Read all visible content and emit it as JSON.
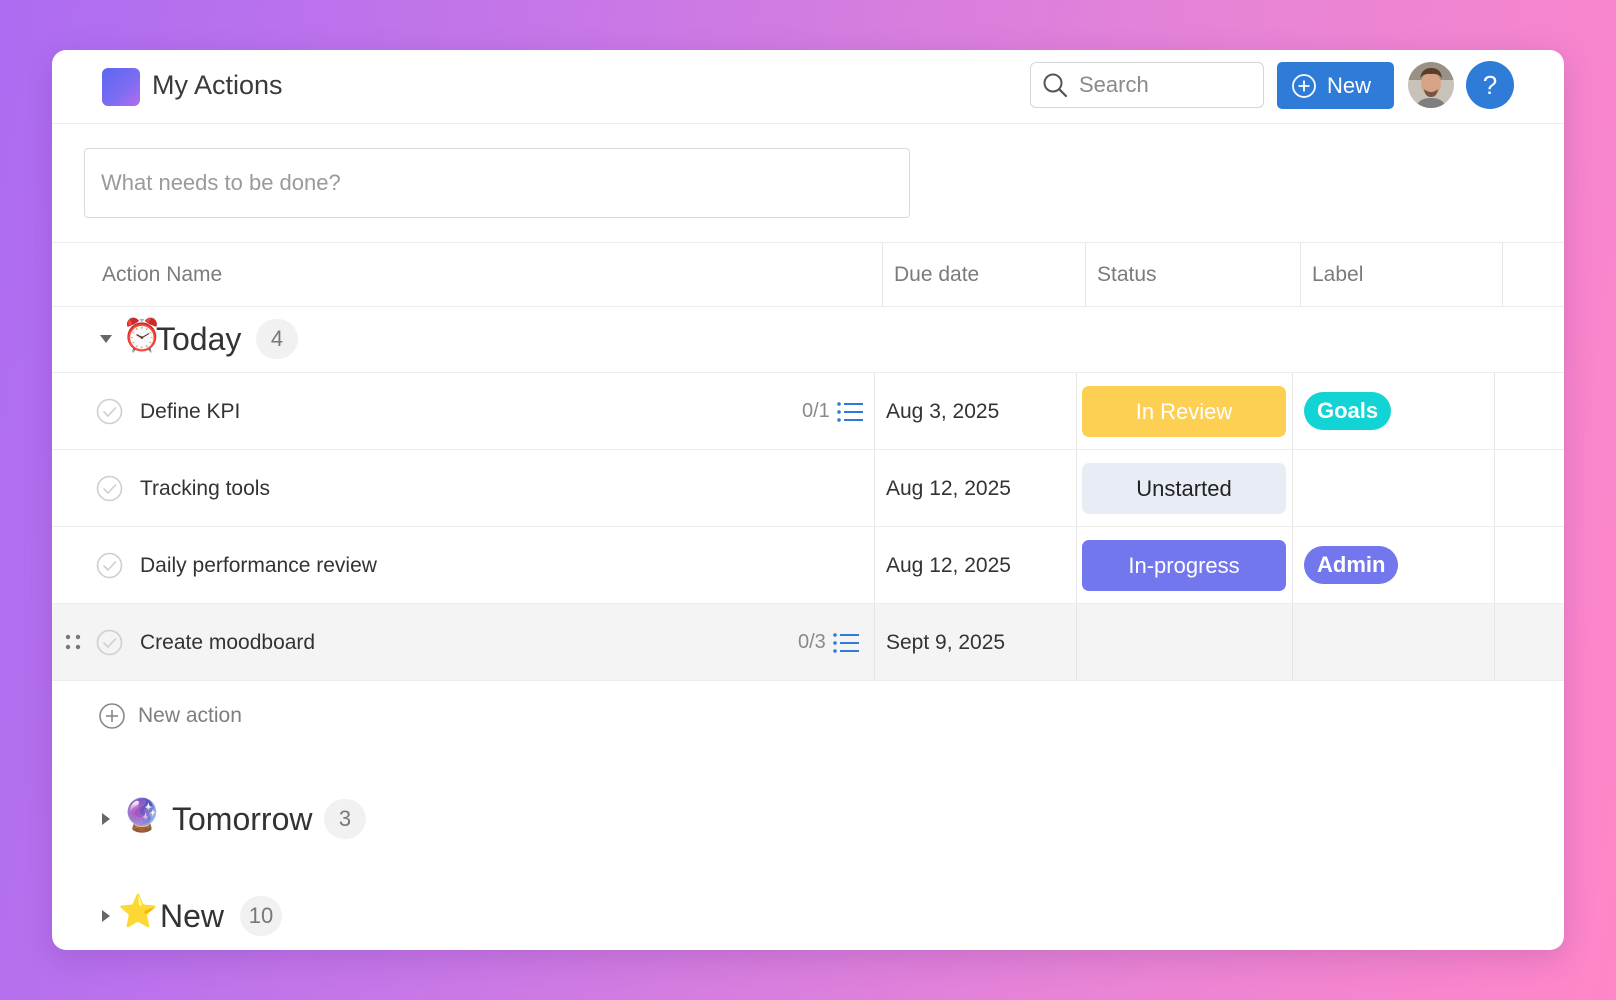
{
  "app": {
    "title": "My Actions"
  },
  "header": {
    "search_placeholder": "Search",
    "new_button_label": "New",
    "help_label": "?"
  },
  "quick_add": {
    "placeholder": "What needs to be done?"
  },
  "columns": [
    "Action Name",
    "Due date",
    "Status",
    "Label"
  ],
  "groups": [
    {
      "title": "Today",
      "emoji": "⏰",
      "count": "4",
      "expanded": true,
      "rows": [
        {
          "name": "Define KPI",
          "subtasks": "0/1",
          "due": "Aug 3, 2025",
          "status": "In Review",
          "label": "Goals"
        },
        {
          "name": "Tracking tools",
          "subtasks": "",
          "due": "Aug 12, 2025",
          "status": "Unstarted",
          "label": ""
        },
        {
          "name": "Daily performance review",
          "subtasks": "",
          "due": "Aug 12, 2025",
          "status": "In-progress",
          "label": "Admin"
        },
        {
          "name": "Create moodboard",
          "subtasks": "0/3",
          "due": "Sept 9, 2025",
          "status": "",
          "label": ""
        }
      ],
      "new_action_label": "New action"
    },
    {
      "title": "Tomorrow",
      "emoji": "🔮",
      "count": "3",
      "expanded": false
    },
    {
      "title": "New",
      "emoji": "⭐",
      "count": "10",
      "expanded": false
    }
  ],
  "colors": {
    "accent": "#2f7bd8",
    "status_in_review": "#fdd053",
    "status_unstarted": "#e8ecf4",
    "status_in_progress": "#7377ee",
    "label_goals": "#12d4d4",
    "label_admin": "#7377ee"
  }
}
